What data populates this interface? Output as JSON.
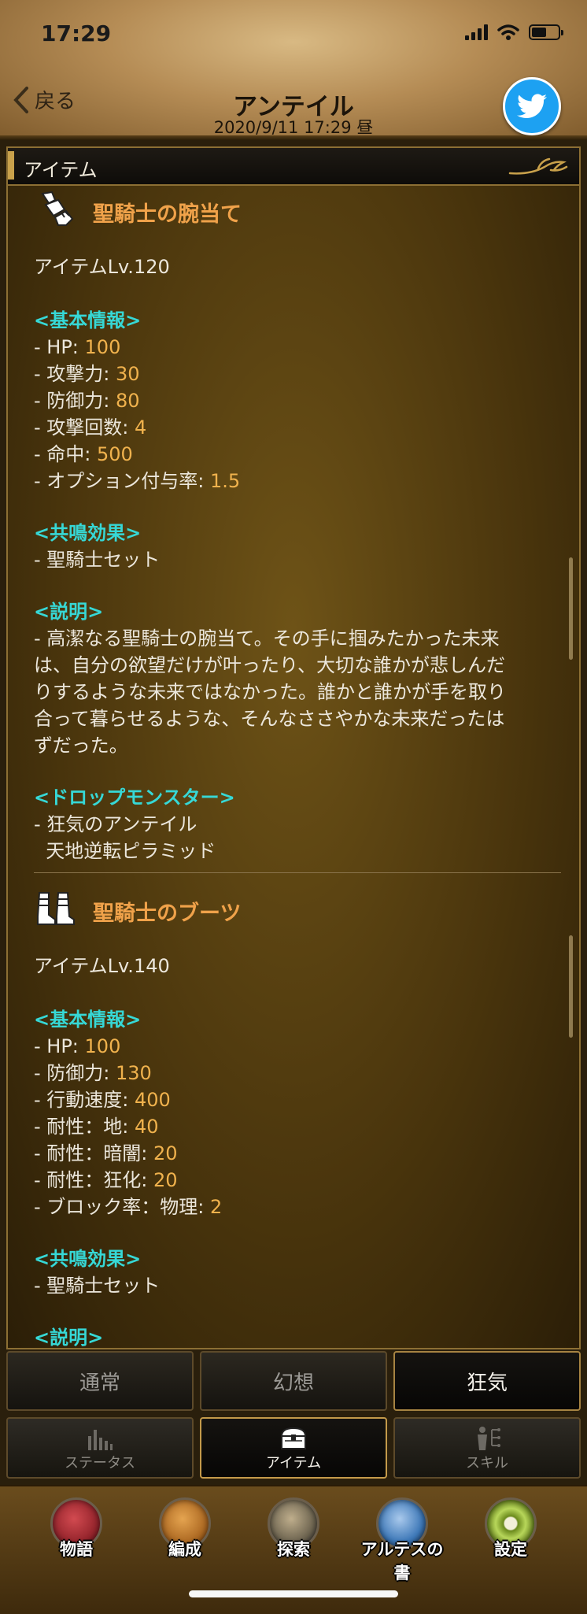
{
  "status": {
    "time": "17:29"
  },
  "header": {
    "back_label": "戻る",
    "title": "アンテイル",
    "datetime": "2020/9/11  17:29  昼"
  },
  "panel": {
    "title": "アイテム"
  },
  "items": [
    {
      "name": "聖騎士の腕当て",
      "level": "アイテムLv.120",
      "basic_header": "<基本情報>",
      "stats": [
        {
          "label": "- HP: ",
          "value": "100"
        },
        {
          "label": "- 攻撃力: ",
          "value": "30"
        },
        {
          "label": "- 防御力: ",
          "value": "80"
        },
        {
          "label": "- 攻撃回数: ",
          "value": "4"
        },
        {
          "label": "- 命中: ",
          "value": "500"
        },
        {
          "label": "- オプション付与率: ",
          "value": "1.5"
        }
      ],
      "resonance_header": "<共鳴効果>",
      "resonance": "- 聖騎士セット",
      "desc_header": "<説明>",
      "desc_lines": [
        "- 高潔なる聖騎士の腕当て。その手に掴みたかった未来",
        "は、自分の欲望だけが叶ったり、大切な誰かが悲しんだ",
        "りするような未来ではなかった。誰かと誰かが手を取り",
        "合って暮らせるような、そんなささやかな未来だったは",
        "ずだった。"
      ],
      "drop_header": "<ドロップモンスター>",
      "drop_lines": [
        "- 狂気のアンテイル",
        "  天地逆転ピラミッド"
      ]
    },
    {
      "name": "聖騎士のブーツ",
      "level": "アイテムLv.140",
      "basic_header": "<基本情報>",
      "stats": [
        {
          "label": "- HP: ",
          "value": "100"
        },
        {
          "label": "- 防御力: ",
          "value": "130"
        },
        {
          "label": "- 行動速度: ",
          "value": "400"
        },
        {
          "label": "- 耐性：地: ",
          "value": "40"
        },
        {
          "label": "- 耐性：暗闇: ",
          "value": "20"
        },
        {
          "label": "- 耐性：狂化: ",
          "value": "20"
        },
        {
          "label": "- ブロック率：物理: ",
          "value": "2"
        }
      ],
      "resonance_header": "<共鳴効果>",
      "resonance": "- 聖騎士セット",
      "desc_header": "<説明>"
    }
  ],
  "mode_tabs": [
    "通常",
    "幻想",
    "狂気"
  ],
  "sub_tabs": [
    "ステータス",
    "アイテム",
    "スキル"
  ],
  "bottom_nav": [
    "物語",
    "編成",
    "探索",
    "アルテスの書",
    "設定"
  ],
  "colors": {
    "section": "#36d8d6",
    "value": "#f0b24d",
    "item_name": "#f0a24a"
  }
}
